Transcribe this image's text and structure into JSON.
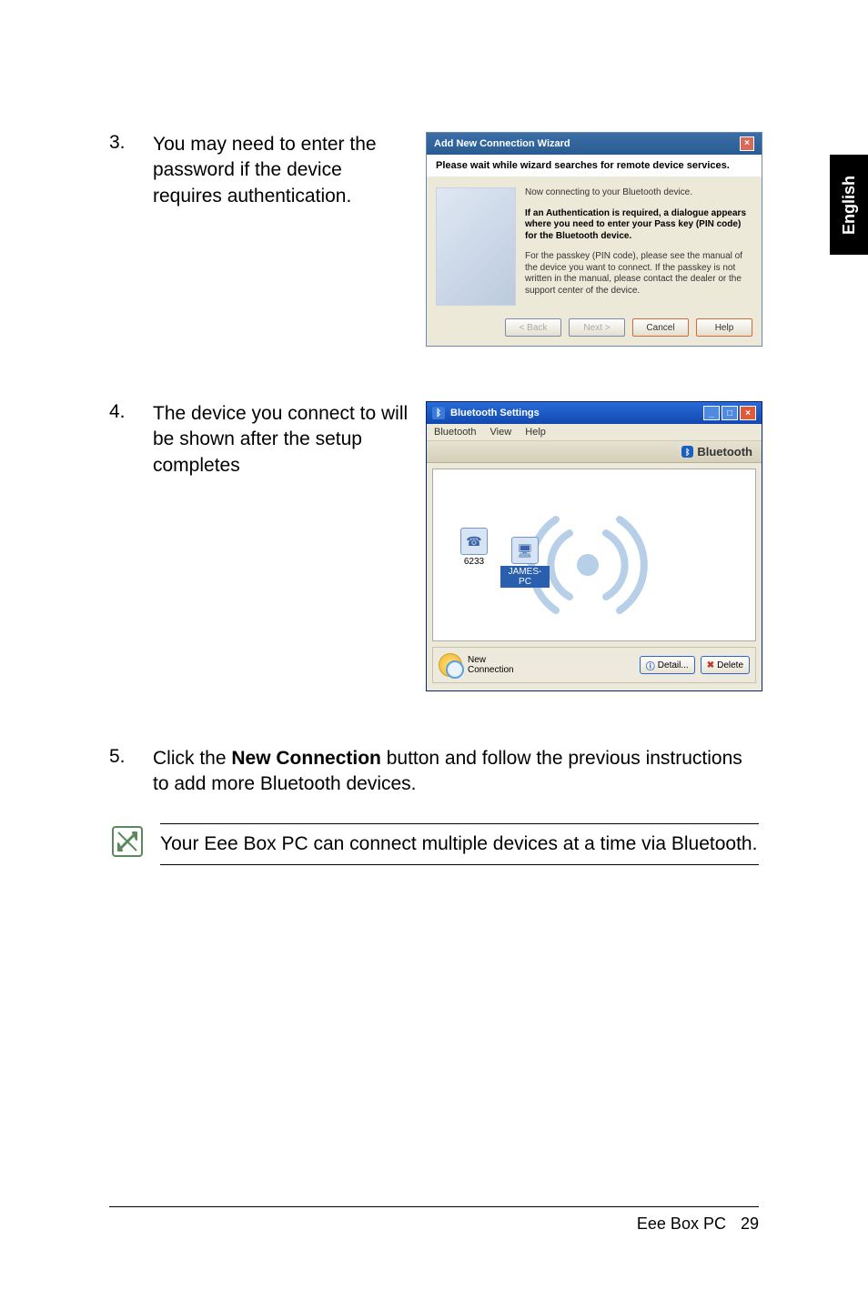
{
  "language_tab": "English",
  "steps": {
    "s3": {
      "num": "3.",
      "text": "You may need to enter the password if the device requires authentication."
    },
    "s4": {
      "num": "4.",
      "text": "The device you connect to will be shown after the setup completes"
    },
    "s5": {
      "num": "5.",
      "text_before": "Click the ",
      "bold": "New Connection",
      "text_after": " button and follow the previous instructions to add more Bluetooth devices."
    }
  },
  "wizard": {
    "title": "Add New Connection Wizard",
    "subtitle": "Please wait while wizard searches for remote device services.",
    "line1": "Now connecting to your Bluetooth device.",
    "line2": "If an Authentication is required, a dialogue appears where you need to enter your Pass key (PIN code) for the Bluetooth device.",
    "line3": "For the passkey (PIN code), please see the manual of the device you want to connect. If the passkey is not written in the manual, please contact the dealer or the support center of the device.",
    "btn_back": "< Back",
    "btn_next": "Next >",
    "btn_cancel": "Cancel",
    "btn_help": "Help"
  },
  "bt": {
    "title": "Bluetooth Settings",
    "menu": {
      "m1": "Bluetooth",
      "m2": "View",
      "m3": "Help"
    },
    "brand": "Bluetooth",
    "devices": {
      "d1": "6233",
      "d2": "JAMES-PC"
    },
    "new_connection_line1": "New",
    "new_connection_line2": "Connection",
    "btn_detail": "Detail...",
    "btn_delete": "Delete"
  },
  "note": "Your Eee Box PC can connect multiple devices at a time via Bluetooth.",
  "footer": {
    "product": "Eee Box PC",
    "page": "29"
  }
}
